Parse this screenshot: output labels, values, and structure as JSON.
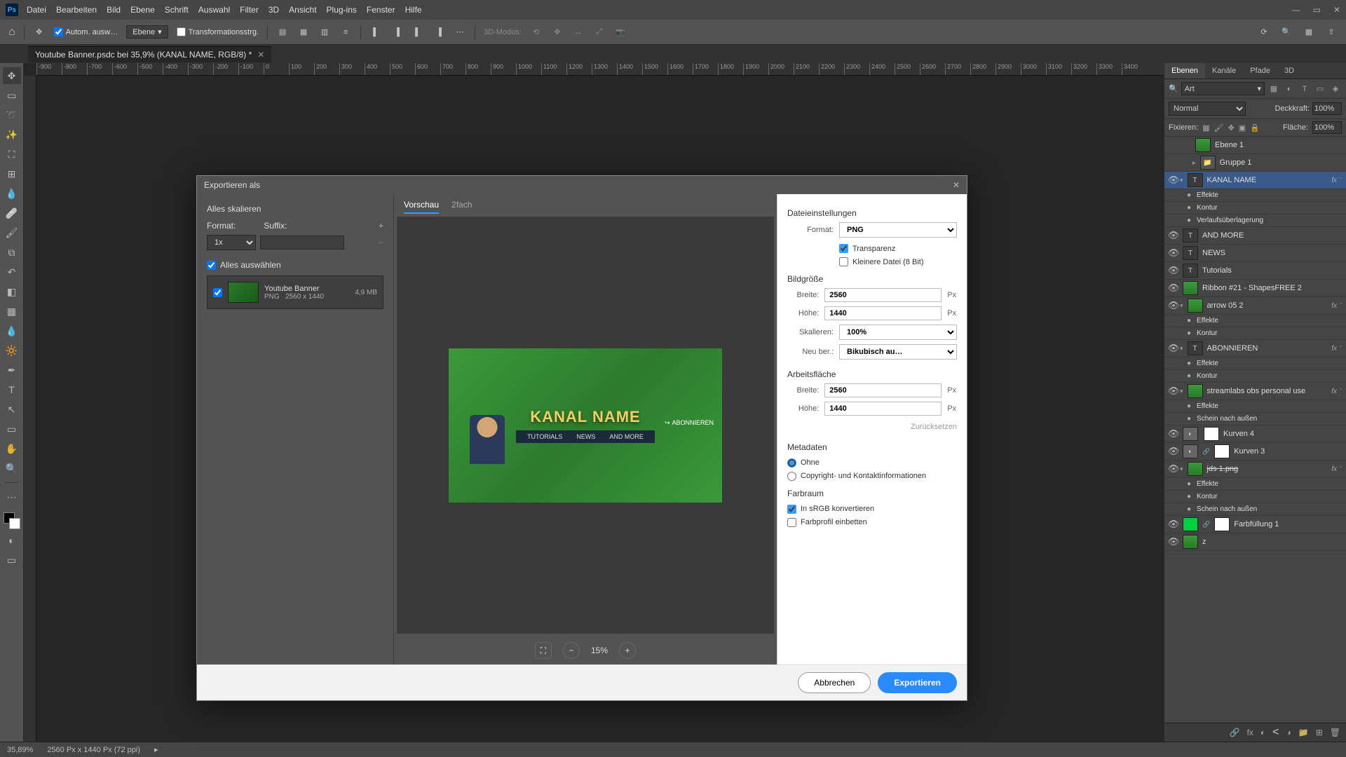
{
  "menubar": {
    "items": [
      "Datei",
      "Bearbeiten",
      "Bild",
      "Ebene",
      "Schrift",
      "Auswahl",
      "Filter",
      "3D",
      "Ansicht",
      "Plug-ins",
      "Fenster",
      "Hilfe"
    ]
  },
  "optbar": {
    "auto_select": "Autom. ausw…",
    "layer_select": "Ebene",
    "transform": "Transformationsstrg.",
    "mode3d": "3D-Modus:"
  },
  "document": {
    "tab_title": "Youtube Banner.psdc bei 35,9% (KANAL NAME, RGB/8) *"
  },
  "ruler_ticks": [
    "-900",
    "-800",
    "-700",
    "-600",
    "-500",
    "-400",
    "-300",
    "-200",
    "-100",
    "0",
    "100",
    "200",
    "300",
    "400",
    "500",
    "600",
    "700",
    "800",
    "900",
    "1000",
    "1100",
    "1200",
    "1300",
    "1400",
    "1500",
    "1600",
    "1700",
    "1800",
    "1900",
    "2000",
    "2100",
    "2200",
    "2300",
    "2400",
    "2500",
    "2600",
    "2700",
    "2800",
    "2900",
    "3000",
    "3100",
    "3200",
    "3300",
    "3400"
  ],
  "panels": {
    "tabs": [
      "Ebenen",
      "Kanäle",
      "Pfade",
      "3D"
    ],
    "search_kind": "Art",
    "blend_mode": "Normal",
    "opacity_label": "Deckkraft:",
    "opacity_value": "100%",
    "lock_label": "Fixieren:",
    "fill_label": "Fläche:",
    "fill_value": "100%",
    "layers": [
      {
        "vis": "",
        "type": "layer",
        "name": "Ebene 1",
        "fx": false,
        "indent": 1
      },
      {
        "vis": "",
        "type": "group",
        "name": "Gruppe 1",
        "fx": false,
        "indent": 1,
        "expand": "▸"
      },
      {
        "vis": "●",
        "type": "text",
        "name": "KANAL NAME",
        "fx": true,
        "indent": 0,
        "selected": true,
        "expand": "▾"
      },
      {
        "vis": "",
        "type": "sub",
        "name": "Effekte",
        "indent": 2
      },
      {
        "vis": "",
        "type": "sub",
        "name": "Kontur",
        "indent": 2
      },
      {
        "vis": "",
        "type": "sub",
        "name": "Verlaufsüberlagerung",
        "indent": 2
      },
      {
        "vis": "●",
        "type": "text",
        "name": "AND MORE",
        "fx": false,
        "indent": 0
      },
      {
        "vis": "●",
        "type": "text",
        "name": "NEWS",
        "fx": false,
        "indent": 0
      },
      {
        "vis": "●",
        "type": "text",
        "name": "Tutorials",
        "fx": false,
        "indent": 0
      },
      {
        "vis": "●",
        "type": "layer",
        "name": "Ribbon #21 - ShapesFREE 2",
        "fx": false,
        "indent": 0
      },
      {
        "vis": "●",
        "type": "layer",
        "name": "arrow 05 2",
        "fx": true,
        "indent": 0,
        "expand": "▾"
      },
      {
        "vis": "",
        "type": "sub",
        "name": "Effekte",
        "indent": 2
      },
      {
        "vis": "",
        "type": "sub",
        "name": "Kontur",
        "indent": 2
      },
      {
        "vis": "●",
        "type": "text",
        "name": "ABONNIEREN",
        "fx": true,
        "indent": 0,
        "expand": "▾"
      },
      {
        "vis": "",
        "type": "sub",
        "name": "Effekte",
        "indent": 2
      },
      {
        "vis": "",
        "type": "sub",
        "name": "Kontur",
        "indent": 2
      },
      {
        "vis": "●",
        "type": "smart",
        "name": "streamlabs obs personal use",
        "fx": true,
        "indent": 0,
        "expand": "▾"
      },
      {
        "vis": "",
        "type": "sub",
        "name": "Effekte",
        "indent": 2
      },
      {
        "vis": "",
        "type": "sub",
        "name": "Schein nach außen",
        "indent": 2
      },
      {
        "vis": "●",
        "type": "adj-mask",
        "name": "Kurven 4",
        "fx": false,
        "indent": 0
      },
      {
        "vis": "●",
        "type": "adj-mask",
        "name": "Kurven 3",
        "fx": false,
        "indent": 0,
        "link": true
      },
      {
        "vis": "●",
        "type": "smart",
        "name": "jds 1.png",
        "fx": true,
        "indent": 0,
        "expand": "▾",
        "strike": true
      },
      {
        "vis": "",
        "type": "sub",
        "name": "Effekte",
        "indent": 2
      },
      {
        "vis": "",
        "type": "sub",
        "name": "Kontur",
        "indent": 2
      },
      {
        "vis": "",
        "type": "sub",
        "name": "Schein nach außen",
        "indent": 2
      },
      {
        "vis": "●",
        "type": "fill-mask",
        "name": "Farbfüllung 1",
        "fx": false,
        "indent": 0
      },
      {
        "vis": "●",
        "type": "layer",
        "name": "z",
        "fx": false,
        "indent": 0
      }
    ]
  },
  "statusbar": {
    "zoom": "35,89%",
    "dims": "2560 Px x 1440 Px (72 ppi)"
  },
  "dialog": {
    "title": "Exportieren als",
    "left": {
      "scale_all": "Alles skalieren",
      "format_label": "Format:",
      "suffix_label": "Suffix:",
      "scale_value": "1x",
      "select_all": "Alles auswählen",
      "asset": {
        "name": "Youtube Banner",
        "format": "PNG",
        "dims": "2560 x 1440",
        "size": "4,9 MB"
      }
    },
    "center": {
      "tab_preview": "Vorschau",
      "tab_2x": "2fach",
      "banner_title": "KANAL NAME",
      "banner_tutorials": "TUTORIALS",
      "banner_news": "NEWS",
      "banner_more": "AND MORE",
      "banner_sub": "ABONNIEREN",
      "zoom": "15%"
    },
    "right": {
      "file_settings": "Dateieinstellungen",
      "format_label": "Format:",
      "format_value": "PNG",
      "transparency": "Transparenz",
      "smaller_file": "Kleinere Datei (8 Bit)",
      "image_size": "Bildgröße",
      "width_label": "Breite:",
      "width_value": "2560",
      "height_label": "Höhe:",
      "height_value": "1440",
      "scale_label": "Skalieren:",
      "scale_value": "100%",
      "resample_label": "Neu ber.:",
      "resample_value": "Bikubisch au…",
      "canvas": "Arbeitsfläche",
      "canvas_width": "2560",
      "canvas_height": "1440",
      "reset": "Zurücksetzen",
      "metadata": "Metadaten",
      "meta_none": "Ohne",
      "meta_contact": "Copyright- und Kontaktinformationen",
      "colorspace": "Farbraum",
      "srgb": "In sRGB konvertieren",
      "embed": "Farbprofil einbetten",
      "px": "Px"
    },
    "footer": {
      "cancel": "Abbrechen",
      "export": "Exportieren"
    }
  }
}
